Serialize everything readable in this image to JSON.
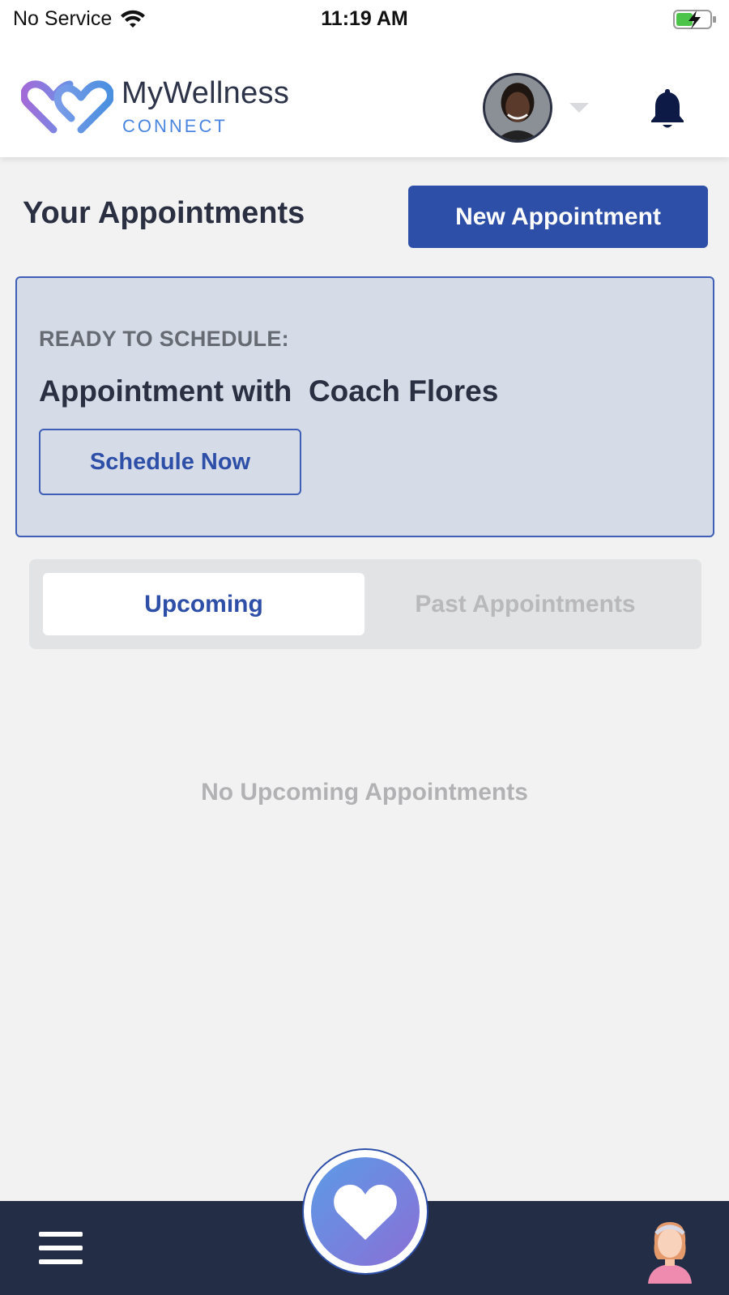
{
  "status_bar": {
    "carrier": "No Service",
    "time": "11:19 AM",
    "wifi_icon": "wifi-icon",
    "battery_icon": "battery-charging-icon"
  },
  "header": {
    "logo_name": "MyWellness",
    "logo_sub": "CONNECT",
    "avatar_icon": "user-avatar",
    "dropdown_icon": "chevron-down-icon",
    "notification_icon": "bell-icon"
  },
  "page": {
    "title": "Your Appointments",
    "new_appointment_label": "New Appointment"
  },
  "ready_card": {
    "label": "READY TO SCHEDULE:",
    "title": "Appointment with  Coach Flores",
    "button_label": "Schedule Now"
  },
  "tabs": {
    "upcoming": "Upcoming",
    "past": "Past Appointments",
    "selected": "Upcoming"
  },
  "empty_state": "No Upcoming Appointments",
  "bottom_nav": {
    "menu_icon": "menu-icon",
    "center_icon": "heart-icon",
    "profile_icon": "profile-icon"
  },
  "colors": {
    "primary": "#2e4fa8",
    "nav_background": "#232d45",
    "card_background": "#d6dce7",
    "page_background": "#f2f2f2"
  }
}
